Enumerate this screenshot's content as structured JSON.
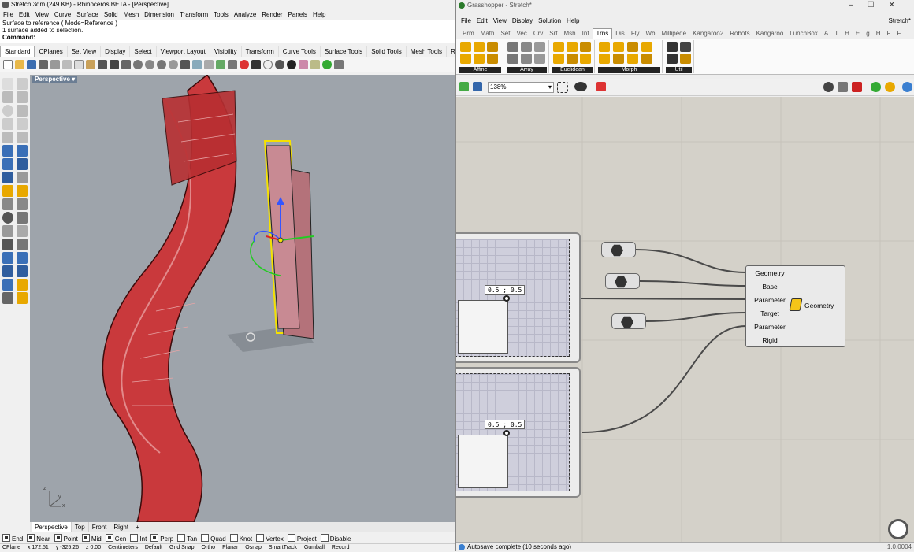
{
  "rhino": {
    "title": "Stretch.3dm (249 KB) - Rhinoceros BETA - [Perspective]",
    "menu": [
      "File",
      "Edit",
      "View",
      "Curve",
      "Surface",
      "Solid",
      "Mesh",
      "Dimension",
      "Transform",
      "Tools",
      "Analyze",
      "Render",
      "Panels",
      "Help"
    ],
    "command_history": [
      "Surface to reference ( Mode=Reference )",
      "1 surface added to selection."
    ],
    "command_label": "Command:",
    "toolbar_tabs": [
      "Standard",
      "CPlanes",
      "Set View",
      "Display",
      "Select",
      "Viewport Layout",
      "Visibility",
      "Transform",
      "Curve Tools",
      "Surface Tools",
      "Solid Tools",
      "Mesh Tools",
      "Render T"
    ],
    "active_tab": "Standard",
    "viewport_label": "Perspective",
    "axis_labels": {
      "z": "z",
      "x": "x",
      "y": "y"
    },
    "viewport_tabs": [
      "Perspective",
      "Top",
      "Front",
      "Right",
      "+"
    ],
    "osnaps": [
      {
        "label": "End",
        "on": true
      },
      {
        "label": "Near",
        "on": true
      },
      {
        "label": "Point",
        "on": true
      },
      {
        "label": "Mid",
        "on": true
      },
      {
        "label": "Cen",
        "on": true
      },
      {
        "label": "Int",
        "on": false
      },
      {
        "label": "Perp",
        "on": true
      },
      {
        "label": "Tan",
        "on": false
      },
      {
        "label": "Quad",
        "on": false
      },
      {
        "label": "Knot",
        "on": false
      },
      {
        "label": "Vertex",
        "on": false
      },
      {
        "label": "Project",
        "on": false
      },
      {
        "label": "Disable",
        "on": false
      }
    ],
    "status": [
      "CPlane",
      "x 172.51",
      "y -325.26",
      "z 0.00",
      "Centimeters",
      "Default",
      "Grid Snap",
      "Ortho",
      "Planar",
      "Osnap",
      "SmartTrack",
      "Gumball",
      "Record"
    ]
  },
  "gh": {
    "title": "Grasshopper - Stretch*",
    "window_controls": "–☐✕",
    "menu": [
      "File",
      "Edit",
      "View",
      "Display",
      "Solution",
      "Help"
    ],
    "doc_name": "Stretch*",
    "tabs": [
      "Prm",
      "Math",
      "Set",
      "Vec",
      "Crv",
      "Srf",
      "Msh",
      "Int",
      "Trns",
      "Dis",
      "Fly",
      "Wb",
      "Millipede",
      "Kangaroo2",
      "Robots",
      "Kangaroo",
      "LunchBox",
      "A",
      "T",
      "H",
      "E",
      "g",
      "H",
      "F",
      "F"
    ],
    "active_tab": "Trns",
    "groups": [
      "Affine",
      "Array",
      "Euclidean",
      "Morph",
      "Util"
    ],
    "zoom": "138%",
    "component": {
      "inputs": [
        "Geometry",
        "Base",
        "Parameter",
        "Target",
        "Parameter",
        "Rigid"
      ],
      "output": "Geometry"
    },
    "panel1_readout": "0.5 ; 0.5",
    "panel2_readout": "0.5 ; 0.5",
    "status": "Autosave complete (10 seconds ago)",
    "version": "1.0.0004"
  },
  "colors": {
    "viewport_bg": "#9ea4ab",
    "surface_red": "#c9393c",
    "canvas_bg": "#d4d1c9",
    "selection_yellow": "#f5e100"
  }
}
